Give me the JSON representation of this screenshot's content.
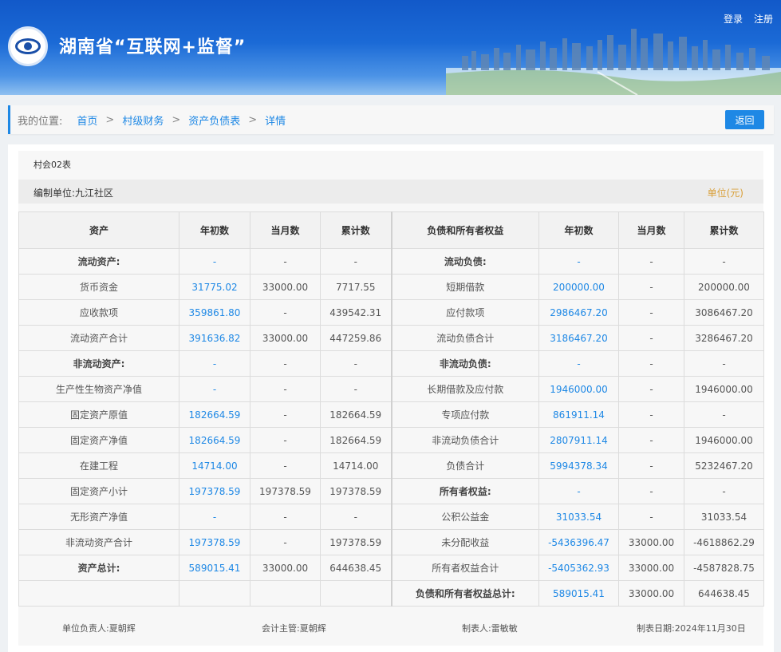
{
  "header": {
    "site_title": "湖南省“互联网+监督”",
    "login_label": "登录",
    "register_label": "注册"
  },
  "breadcrumb": {
    "label": "我的位置:",
    "items": [
      "首页",
      "村级财务",
      "资产负债表",
      "详情"
    ],
    "back_label": "返回"
  },
  "report": {
    "form_code": "村会02表",
    "org_label": "编制单位:九江社区",
    "unit_label": "单位(元)",
    "columns": [
      "资产",
      "年初数",
      "当月数",
      "累计数",
      "负债和所有者权益",
      "年初数",
      "当月数",
      "累计数"
    ],
    "rows": [
      [
        "流动资产:",
        "-",
        "-",
        "-",
        "流动负债:",
        "-",
        "-",
        "-"
      ],
      [
        "货币资金",
        "31775.02",
        "33000.00",
        "7717.55",
        "短期借款",
        "200000.00",
        "-",
        "200000.00"
      ],
      [
        "应收款项",
        "359861.80",
        "-",
        "439542.31",
        "应付款项",
        "2986467.20",
        "-",
        "3086467.20"
      ],
      [
        "流动资产合计",
        "391636.82",
        "33000.00",
        "447259.86",
        "流动负债合计",
        "3186467.20",
        "-",
        "3286467.20"
      ],
      [
        "非流动资产:",
        "-",
        "-",
        "-",
        "非流动负债:",
        "-",
        "-",
        "-"
      ],
      [
        "生产性生物资产净值",
        "-",
        "-",
        "-",
        "长期借款及应付款",
        "1946000.00",
        "-",
        "1946000.00"
      ],
      [
        "固定资产原值",
        "182664.59",
        "-",
        "182664.59",
        "专项应付款",
        "861911.14",
        "-",
        "-"
      ],
      [
        "固定资产净值",
        "182664.59",
        "-",
        "182664.59",
        "非流动负债合计",
        "2807911.14",
        "-",
        "1946000.00"
      ],
      [
        "在建工程",
        "14714.00",
        "-",
        "14714.00",
        "负债合计",
        "5994378.34",
        "-",
        "5232467.20"
      ],
      [
        "固定资产小计",
        "197378.59",
        "197378.59",
        "197378.59",
        "所有者权益:",
        "-",
        "-",
        "-"
      ],
      [
        "无形资产净值",
        "-",
        "-",
        "-",
        "公积公益金",
        "31033.54",
        "-",
        "31033.54"
      ],
      [
        "非流动资产合计",
        "197378.59",
        "-",
        "197378.59",
        "未分配收益",
        "-5436396.47",
        "33000.00",
        "-4618862.29"
      ],
      [
        "资产总计:",
        "589015.41",
        "33000.00",
        "644638.45",
        "所有者权益合计",
        "-5405362.93",
        "33000.00",
        "-4587828.75"
      ],
      [
        "",
        "",
        "",
        "",
        "负债和所有者权益总计:",
        "589015.41",
        "33000.00",
        "644638.45"
      ]
    ],
    "bold_labels": [
      "流动资产:",
      "非流动资产:",
      "资产总计:",
      "流动负债:",
      "非流动负债:",
      "所有者权益:",
      "负债和所有者权益总计:"
    ],
    "signatures": {
      "head": "单位负责人:夏朝辉",
      "accountant": "会计主管:夏朝辉",
      "preparer": "制表人:雷敏敏",
      "date": "制表日期:2024年11月30日"
    }
  },
  "colors": {
    "accent": "#1e88e5",
    "unit_text": "#d9a03a",
    "header_top": "#1259c9"
  }
}
